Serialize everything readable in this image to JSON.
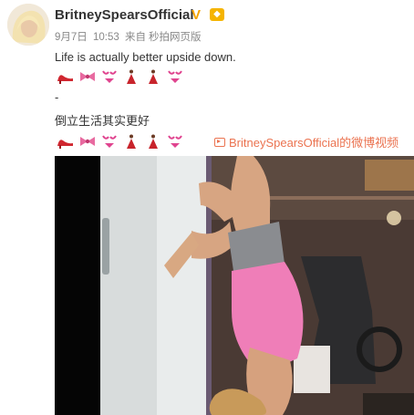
{
  "post": {
    "username": "BritneySpearsOfficial",
    "verified_icon": "verified-v-icon",
    "level_badge": "vip-level-icon",
    "date": "9月7日",
    "time": "10:53",
    "source_prefix": "来自",
    "source": "秒拍网页版",
    "text_line1": "Life is actually better upside down.",
    "dash": "-",
    "text_line2": "倒立生活其实更好",
    "emoji_row": [
      "high-heel-icon",
      "ribbon-icon",
      "bikini-icon",
      "dancer-icon",
      "dancer-icon",
      "bikini-icon"
    ],
    "video_link_label": "BritneySpearsOfficial的微博视频"
  },
  "colors": {
    "link": "#eb7350",
    "meta": "#888888",
    "text": "#333333",
    "verified": "#f5a300"
  }
}
